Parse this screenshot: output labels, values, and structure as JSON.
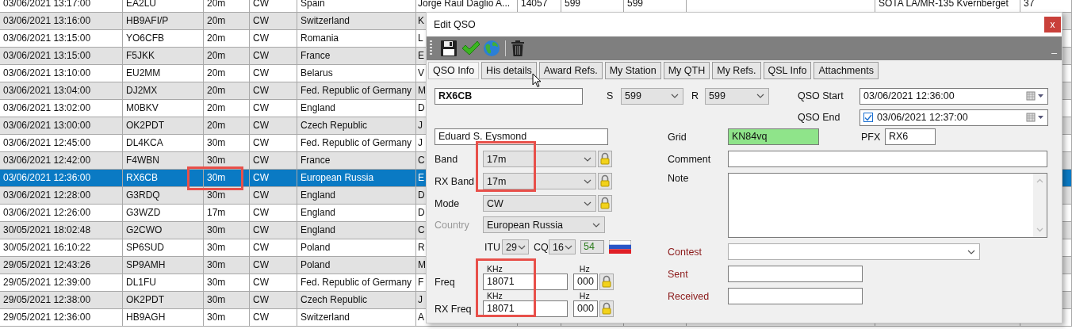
{
  "log_table": {
    "rows": [
      {
        "cells": [
          "03/06/2021 13:17:00",
          "EA2LU",
          "20m",
          "CW",
          "Spain",
          "Jorge Raul Daglio A...",
          "14057",
          "599",
          "599",
          null,
          "SOTA LA/MR-135 Kvernberget",
          "37"
        ],
        "selected": false
      },
      {
        "cells": [
          "03/06/2021 13:16:00",
          "HB9AFI/P",
          "20m",
          "CW",
          "Switzerland",
          "K"
        ],
        "selected": false
      },
      {
        "cells": [
          "03/06/2021 13:15:00",
          "YO6CFB",
          "20m",
          "CW",
          "Romania",
          "L"
        ],
        "selected": false
      },
      {
        "cells": [
          "03/06/2021 13:15:00",
          "F5JKK",
          "20m",
          "CW",
          "France",
          "E"
        ],
        "selected": false
      },
      {
        "cells": [
          "03/06/2021 13:10:00",
          "EU2MM",
          "20m",
          "CW",
          "Belarus",
          "V"
        ],
        "selected": false
      },
      {
        "cells": [
          "03/06/2021 13:04:00",
          "DJ2MX",
          "20m",
          "CW",
          "Fed. Republic of Germany",
          "M"
        ],
        "selected": false
      },
      {
        "cells": [
          "03/06/2021 13:02:00",
          "M0BKV",
          "20m",
          "CW",
          "England",
          "D"
        ],
        "selected": false
      },
      {
        "cells": [
          "03/06/2021 13:00:00",
          "OK2PDT",
          "20m",
          "CW",
          "Czech Republic",
          "J"
        ],
        "selected": false
      },
      {
        "cells": [
          "03/06/2021 12:45:00",
          "DL4KCA",
          "30m",
          "CW",
          "Fed. Republic of Germany",
          "J"
        ],
        "selected": false
      },
      {
        "cells": [
          "03/06/2021 12:42:00",
          "F4WBN",
          "30m",
          "CW",
          "France",
          "C"
        ],
        "selected": false
      },
      {
        "cells": [
          "03/06/2021 12:36:00",
          "RX6CB",
          "30m",
          "CW",
          "European Russia",
          "E"
        ],
        "selected": true
      },
      {
        "cells": [
          "03/06/2021 12:28:00",
          "G3RDQ",
          "30m",
          "CW",
          "England",
          "D"
        ],
        "selected": false
      },
      {
        "cells": [
          "03/06/2021 12:26:00",
          "G3WZD",
          "17m",
          "CW",
          "England",
          "D"
        ],
        "selected": false
      },
      {
        "cells": [
          "30/05/2021 18:02:48",
          "G2CWO",
          "30m",
          "CW",
          "England",
          "C"
        ],
        "selected": false
      },
      {
        "cells": [
          "30/05/2021 16:10:22",
          "SP6SUD",
          "30m",
          "CW",
          "Poland",
          "R"
        ],
        "selected": false
      },
      {
        "cells": [
          "29/05/2021 12:43:26",
          "SP9AMH",
          "30m",
          "CW",
          "Poland",
          "M"
        ],
        "selected": false
      },
      {
        "cells": [
          "29/05/2021 12:39:00",
          "DL1FU",
          "30m",
          "CW",
          "Fed. Republic of Germany",
          "F"
        ],
        "selected": false
      },
      {
        "cells": [
          "29/05/2021 12:38:00",
          "OK2PDT",
          "30m",
          "CW",
          "Czech Republic",
          "J"
        ],
        "selected": false
      },
      {
        "cells": [
          "29/05/2021 12:36:00",
          "HB9AGH",
          "30m",
          "CW",
          "Switzerland",
          "A"
        ],
        "selected": false
      }
    ]
  },
  "dialog": {
    "title": "Edit QSO",
    "close": "x",
    "collapse": "_",
    "toolbar": [
      {
        "kind": "save"
      },
      {
        "kind": "confirm"
      },
      {
        "kind": "globe"
      },
      {
        "kind": "separator"
      },
      {
        "kind": "delete"
      }
    ],
    "tabs": [
      {
        "label": "QSO Info",
        "selected": true
      },
      {
        "label": "His details",
        "selected": false
      },
      {
        "label": "Award Refs.",
        "selected": false
      },
      {
        "label": "My Station",
        "selected": false
      },
      {
        "label": "My QTH",
        "selected": false
      },
      {
        "label": "My Refs.",
        "selected": false
      },
      {
        "label": "QSL Info",
        "selected": false
      },
      {
        "label": "Attachments",
        "selected": false
      }
    ],
    "callsign": "RX6CB",
    "rst_sent": {
      "label": "S",
      "value": "599"
    },
    "rst_rcvd": {
      "label": "R",
      "value": "599"
    },
    "qso_start": {
      "label": "QSO Start",
      "value": "03/06/2021 12:36:00"
    },
    "qso_end": {
      "label": "QSO End",
      "value": "03/06/2021 12:37:00",
      "checked": true
    },
    "name": "Eduard S. Eysmond",
    "band": {
      "label": "Band",
      "value": "17m"
    },
    "rx_band": {
      "label": "RX Band",
      "value": "17m"
    },
    "mode": {
      "label": "Mode",
      "value": "CW"
    },
    "country": {
      "label": "Country",
      "value": "European Russia"
    },
    "itu": {
      "label": "ITU",
      "value": "29"
    },
    "cq": {
      "label": "CQ",
      "value": "16"
    },
    "zone_box": "54",
    "freq": {
      "label": "Freq",
      "khz_unit": "KHz",
      "khz": "18071",
      "hz_unit": "Hz",
      "hz": "000"
    },
    "rx_freq": {
      "label": "RX Freq",
      "khz_unit": "KHz",
      "khz": "18071",
      "hz_unit": "Hz",
      "hz": "000"
    },
    "grid": {
      "label": "Grid",
      "value": "KN84vq",
      "valid": true
    },
    "pfx": {
      "label": "PFX",
      "value": "RX6"
    },
    "comment": {
      "label": "Comment"
    },
    "note": {
      "label": "Note"
    },
    "contest": {
      "label": "Contest"
    },
    "sent": {
      "label": "Sent"
    },
    "received": {
      "label": "Received"
    }
  },
  "annotations": [
    {
      "kind": "table-band-cell"
    },
    {
      "kind": "band-fields"
    },
    {
      "kind": "freq-fields"
    }
  ]
}
